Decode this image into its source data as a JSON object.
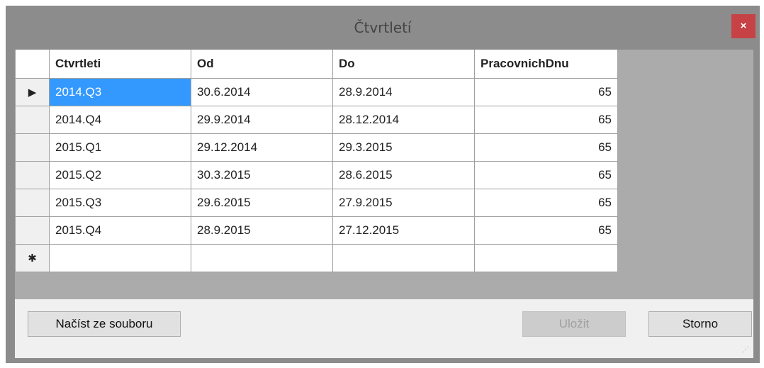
{
  "window": {
    "title": "Čtvrtletí",
    "close_label": "×"
  },
  "grid": {
    "columns": [
      "Ctvrtleti",
      "Od",
      "Do",
      "PracovnichDnu"
    ],
    "current_row_marker": "▶",
    "new_row_marker": "✱",
    "rows": [
      {
        "ctvrtleti": "2014.Q3",
        "od": "30.6.2014",
        "do": "28.9.2014",
        "dnu": "65"
      },
      {
        "ctvrtleti": "2014.Q4",
        "od": "29.9.2014",
        "do": "28.12.2014",
        "dnu": "65"
      },
      {
        "ctvrtleti": "2015.Q1",
        "od": "29.12.2014",
        "do": "29.3.2015",
        "dnu": "65"
      },
      {
        "ctvrtleti": "2015.Q2",
        "od": "30.3.2015",
        "do": "28.6.2015",
        "dnu": "65"
      },
      {
        "ctvrtleti": "2015.Q3",
        "od": "29.6.2015",
        "do": "27.9.2015",
        "dnu": "65"
      },
      {
        "ctvrtleti": "2015.Q4",
        "od": "28.9.2015",
        "do": "27.12.2015",
        "dnu": "65"
      }
    ]
  },
  "buttons": {
    "load": "Načíst ze souboru",
    "save": "Uložit",
    "cancel": "Storno"
  },
  "colors": {
    "titlebar": "#8c8c8c",
    "close": "#c64245",
    "selection": "#3399ff",
    "grid_background": "#ababab"
  }
}
